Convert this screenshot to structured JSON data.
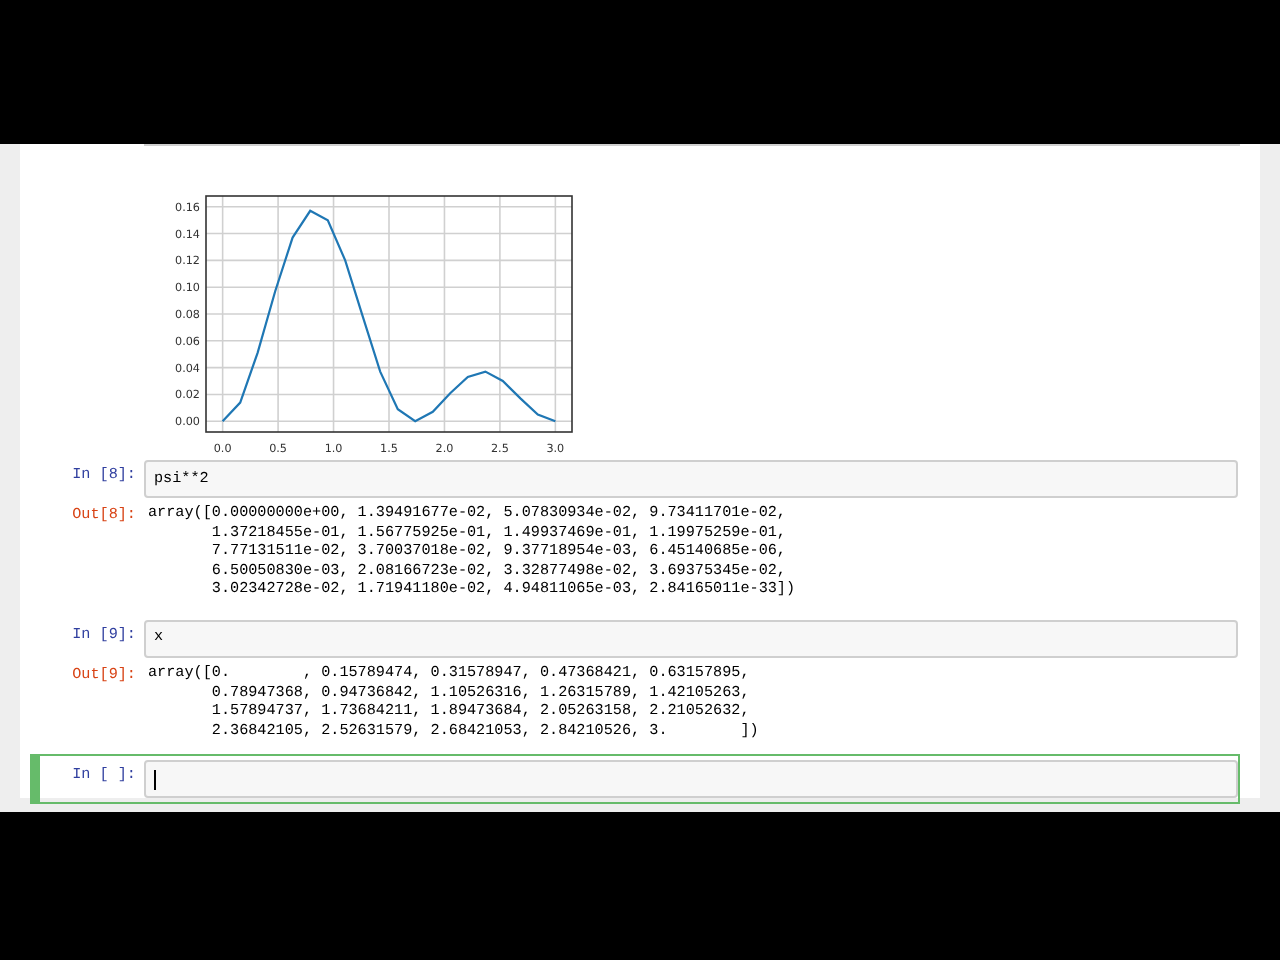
{
  "cells": [
    {
      "kind": "plot",
      "chart_data": {
        "type": "line",
        "grid": true,
        "x": [
          0,
          0.15789474,
          0.31578947,
          0.47368421,
          0.63157895,
          0.78947368,
          0.94736842,
          1.10526316,
          1.26315789,
          1.42105263,
          1.57894737,
          1.73684211,
          1.89473684,
          2.05263158,
          2.21052632,
          2.36842105,
          2.52631579,
          2.68421053,
          2.84210526,
          3.0
        ],
        "series": [
          {
            "color": "#1f77b4",
            "values": [
              0.0,
              0.014,
              0.051,
              0.097,
              0.137,
              0.157,
              0.15,
              0.12,
              0.078,
              0.037,
              0.009,
              0.0,
              0.007,
              0.021,
              0.033,
              0.037,
              0.03,
              0.017,
              0.005,
              0.0
            ]
          }
        ],
        "xlim": [
          -0.15,
          3.15
        ],
        "ylim": [
          -0.008,
          0.168
        ],
        "xticks": [
          {
            "value": 0,
            "label": "0.0"
          },
          {
            "value": 0.5,
            "label": "0.5"
          },
          {
            "value": 1,
            "label": "1.0"
          },
          {
            "value": 1.5,
            "label": "1.5"
          },
          {
            "value": 2,
            "label": "2.0"
          },
          {
            "value": 2.5,
            "label": "2.5"
          },
          {
            "value": 3,
            "label": "3.0"
          }
        ],
        "yticks": [
          {
            "value": 0,
            "label": "0.00"
          },
          {
            "value": 0.02,
            "label": "0.02"
          },
          {
            "value": 0.04,
            "label": "0.04"
          },
          {
            "value": 0.06,
            "label": "0.06"
          },
          {
            "value": 0.08,
            "label": "0.08"
          },
          {
            "value": 0.1,
            "label": "0.10"
          },
          {
            "value": 0.12,
            "label": "0.12"
          },
          {
            "value": 0.14,
            "label": "0.14"
          },
          {
            "value": 0.16,
            "label": "0.16"
          }
        ]
      }
    },
    {
      "kind": "code",
      "selected": false,
      "prompt_in": "In [8]:",
      "code": "psi**2",
      "prompt_out": "Out[8]:",
      "output": [
        "array([0.00000000e+00, 1.39491677e-02, 5.07830934e-02, 9.73411701e-02,",
        "       1.37218455e-01, 1.56775925e-01, 1.49937469e-01, 1.19975259e-01,",
        "       7.77131511e-02, 3.70037018e-02, 9.37718954e-03, 6.45140685e-06,",
        "       6.50050830e-03, 2.08166723e-02, 3.32877498e-02, 3.69375345e-02,",
        "       3.02342728e-02, 1.71941180e-02, 4.94811065e-03, 2.84165011e-33])"
      ]
    },
    {
      "kind": "code",
      "selected": false,
      "prompt_in": "In [9]:",
      "code": "x",
      "prompt_out": "Out[9]:",
      "output": [
        "array([0.        , 0.15789474, 0.31578947, 0.47368421, 0.63157895,",
        "       0.78947368, 0.94736842, 1.10526316, 1.26315789, 1.42105263,",
        "       1.57894737, 1.73684211, 1.89473684, 2.05263158, 2.21052632,",
        "       2.36842105, 2.52631579, 2.68421053, 2.84210526, 3.        ])"
      ]
    },
    {
      "kind": "code",
      "selected": true,
      "prompt_in": "In [ ]:"
    }
  ]
}
